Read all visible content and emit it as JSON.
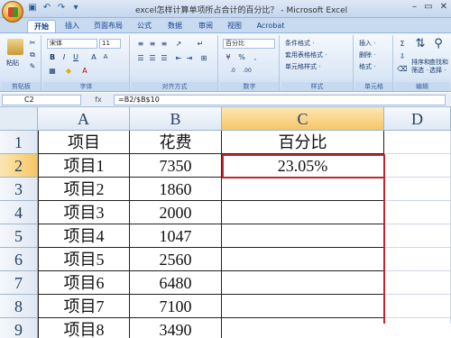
{
  "window": {
    "title": "excel怎样计算单项所占合计的百分比？ - Microsoft Excel",
    "controls": [
      "–",
      "▭",
      "✕"
    ]
  },
  "qat": [
    "save-icon",
    "undo-icon",
    "redo-icon",
    "customize-icon"
  ],
  "ribbon_tabs": [
    "开始",
    "插入",
    "页面布局",
    "公式",
    "数据",
    "审阅",
    "视图",
    "Acrobat"
  ],
  "active_tab": "开始",
  "ribbon": {
    "clipboard": {
      "label": "剪贴板",
      "paste": "粘贴"
    },
    "font": {
      "label": "字体",
      "name": "宋体",
      "size": "11"
    },
    "alignment": {
      "label": "对齐方式"
    },
    "number": {
      "label": "数字",
      "format": "百分比",
      "percent": "%"
    },
    "styles": {
      "label": "样式",
      "items": [
        "条件格式 ·",
        "套用表格格式 ·",
        "单元格样式 ·"
      ]
    },
    "cells": {
      "label": "单元格",
      "items": [
        "插入 ·",
        "删除 ·",
        "格式 ·"
      ]
    },
    "editing": {
      "label": "编辑",
      "sort": "排序和\n筛选 ·",
      "find": "查找和\n选择 ·"
    }
  },
  "formula_bar": {
    "name_box": "C2",
    "fx": "fx",
    "formula": "=B2/$B$10"
  },
  "sheet": {
    "columns": [
      "A",
      "B",
      "C",
      "D"
    ],
    "row_numbers": [
      "1",
      "2",
      "3",
      "4",
      "5",
      "6",
      "7",
      "8",
      "9"
    ],
    "rows": [
      [
        "项目",
        "花费",
        "百分比"
      ],
      [
        "项目1",
        "7350",
        "23.05%"
      ],
      [
        "项目2",
        "1860",
        ""
      ],
      [
        "项目3",
        "2000",
        ""
      ],
      [
        "项目4",
        "1047",
        ""
      ],
      [
        "项目5",
        "2560",
        ""
      ],
      [
        "项目6",
        "6480",
        ""
      ],
      [
        "项目7",
        "7100",
        ""
      ],
      [
        "项目8",
        "3490",
        ""
      ]
    ],
    "selected_cell": "C2",
    "accent_color": "#c0262e"
  }
}
